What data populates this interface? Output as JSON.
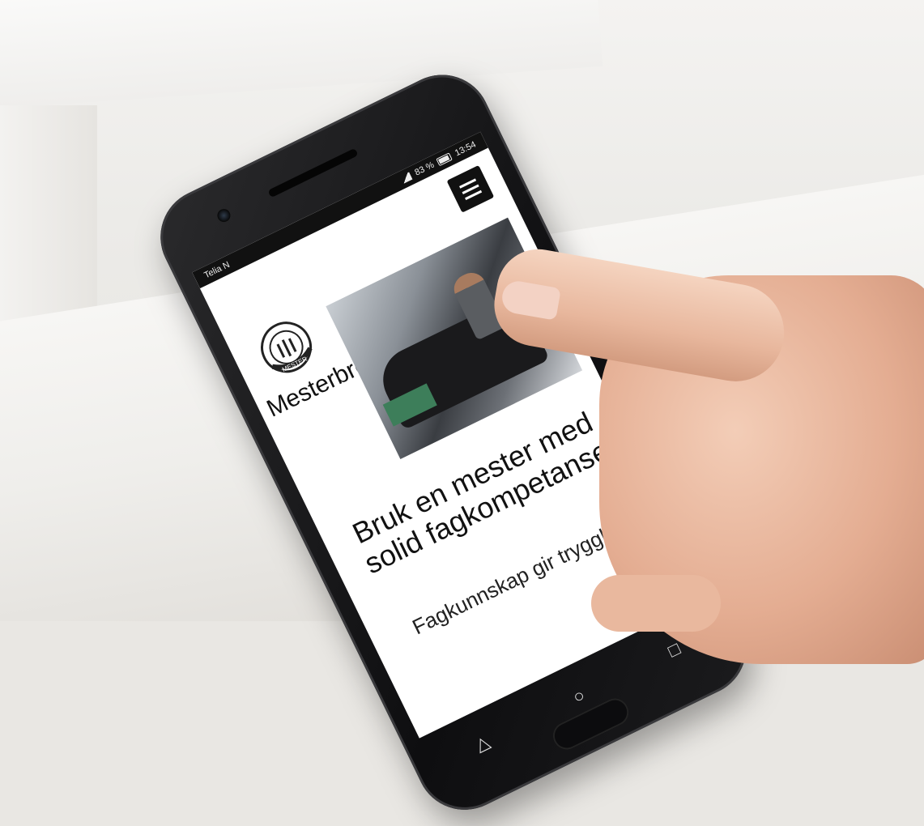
{
  "status_bar": {
    "carrier": "Telia N",
    "battery": "83 %",
    "time": "13:54"
  },
  "site": {
    "brand": "Mesterbrev",
    "logo_text": "MESTER",
    "headline": "Bruk en mester med solid fagkompetanse",
    "subline": "Fagkunnskap gir trygghet"
  },
  "nav_icons": [
    "back-triangle-icon",
    "home-circle-icon",
    "recent-square-icon"
  ],
  "colors": {
    "page_bg": "#ffffff",
    "menu_btn": "#111111",
    "text": "#111111",
    "phone_body": "#0e0e10"
  }
}
